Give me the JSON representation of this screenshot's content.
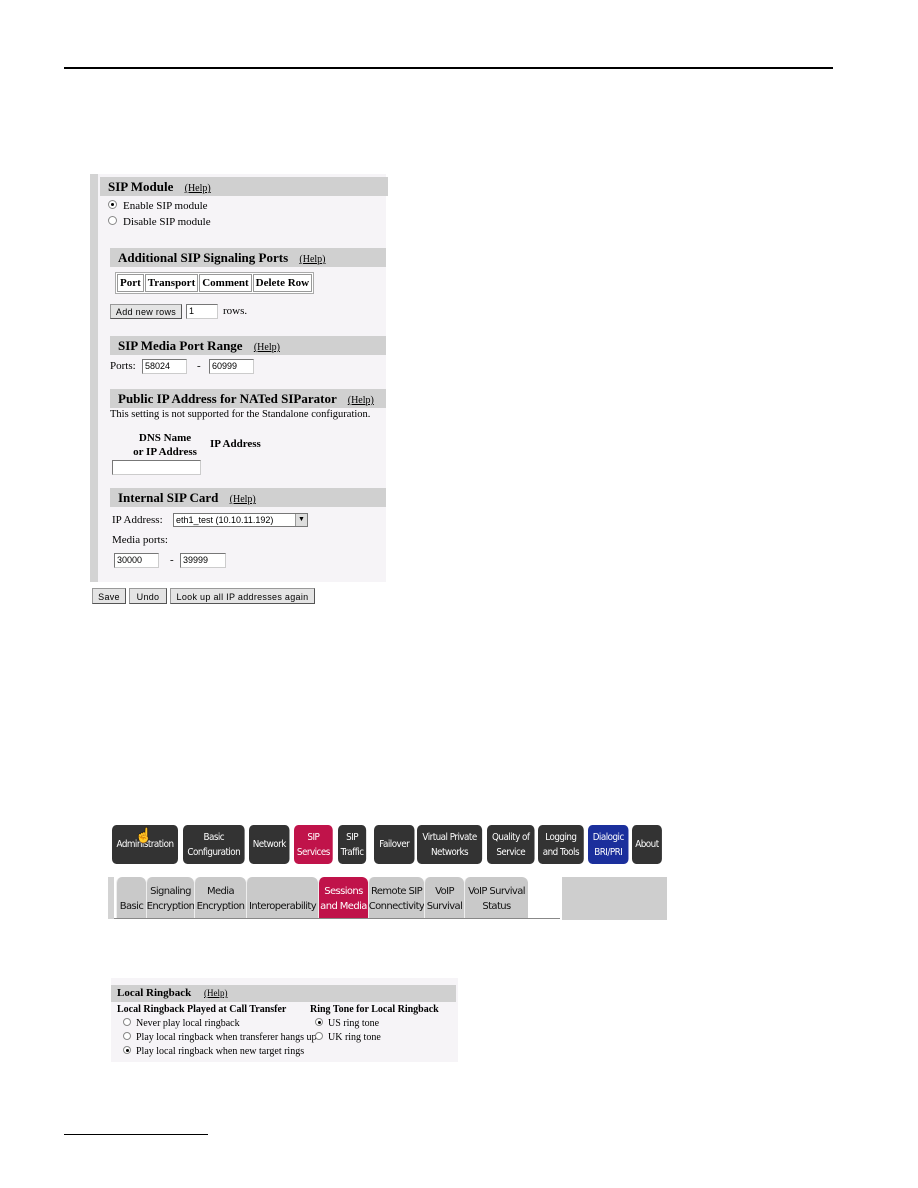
{
  "sip_config": {
    "sip_module": {
      "title": "SIP Module",
      "help": "(Help)",
      "options": [
        {
          "label": "Enable SIP module",
          "selected": true
        },
        {
          "label": "Disable SIP module",
          "selected": false
        }
      ]
    },
    "signaling_ports": {
      "title": "Additional SIP Signaling Ports",
      "help": "(Help)",
      "columns": [
        "Port",
        "Transport",
        "Comment",
        "Delete Row"
      ],
      "add_rows_button": "Add new rows",
      "rows_value": "1",
      "rows_suffix": "rows."
    },
    "media_port_range": {
      "title": "SIP Media Port Range",
      "help": "(Help)",
      "ports_label": "Ports:",
      "from": "58024",
      "separator": "-",
      "to": "60999"
    },
    "public_ip": {
      "title": "Public IP Address for NATed SIParator",
      "help": "(Help)",
      "note": "This setting is not supported for the Standalone configuration.",
      "col_dns_line1": "DNS Name",
      "col_dns_line2": "or IP Address",
      "col_ip": "IP Address",
      "dns_value": ""
    },
    "internal_card": {
      "title": "Internal SIP Card",
      "help": "(Help)",
      "ip_label": "IP Address:",
      "ip_selected": "eth1_test (10.10.11.192)",
      "media_ports_label": "Media ports:",
      "from": "30000",
      "separator": "-",
      "to": "39999"
    },
    "buttons": {
      "save": "Save",
      "undo": "Undo",
      "lookup": "Look up all IP addresses again"
    }
  },
  "nav": {
    "main_tabs": [
      {
        "label": "Administration",
        "state": "normal"
      },
      {
        "label": "Basic Configuration",
        "state": "normal"
      },
      {
        "label": "Network",
        "state": "normal"
      },
      {
        "label": "SIP Services",
        "state": "active"
      },
      {
        "label": "SIP Traffic",
        "state": "normal"
      },
      {
        "label": "Failover",
        "state": "normal"
      },
      {
        "label": "Virtual Private Networks",
        "state": "normal"
      },
      {
        "label": "Quality of Service",
        "state": "normal"
      },
      {
        "label": "Logging and Tools",
        "state": "normal"
      },
      {
        "label": "Dialogic BRI/PRI",
        "state": "dialogic"
      },
      {
        "label": "About",
        "state": "normal"
      }
    ],
    "sub_tabs": [
      {
        "label": "Basic",
        "state": "normal"
      },
      {
        "label": "Signaling Encryption",
        "state": "normal"
      },
      {
        "label": "Media Encryption",
        "state": "normal"
      },
      {
        "label": "Interoperability",
        "state": "normal"
      },
      {
        "label": "Sessions and Media",
        "state": "active"
      },
      {
        "label": "Remote SIP Connectivity",
        "state": "normal"
      },
      {
        "label": "VoIP Survival",
        "state": "normal"
      },
      {
        "label": "VoIP Survival Status",
        "state": "normal"
      }
    ],
    "colors": {
      "dark": "#333333",
      "active": "#c0134a",
      "dialogic": "#1b2f9c",
      "subtab": "#c9c9c9"
    }
  },
  "local_ringback": {
    "title": "Local Ringback",
    "help": "(Help)",
    "transfer": {
      "title": "Local Ringback Played at Call Transfer",
      "options": [
        {
          "label": "Never play local ringback",
          "selected": false
        },
        {
          "label": "Play local ringback when transferer hangs up",
          "selected": false
        },
        {
          "label": "Play local ringback when new target rings",
          "selected": true
        }
      ]
    },
    "ring_tone": {
      "title": "Ring Tone for Local Ringback",
      "options": [
        {
          "label": "US ring tone",
          "selected": true
        },
        {
          "label": "UK ring tone",
          "selected": false
        }
      ]
    }
  }
}
